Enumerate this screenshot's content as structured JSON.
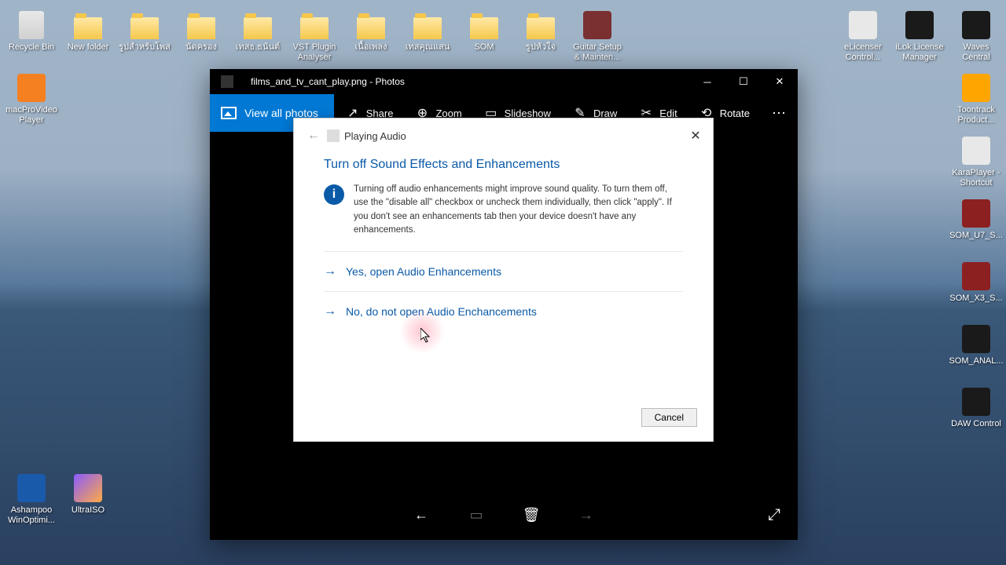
{
  "desktop": {
    "left_rows": [
      [
        {
          "name": "recycle-bin",
          "label": "Recycle Bin",
          "type": "bin"
        },
        {
          "name": "new-folder",
          "label": "New folder",
          "type": "folder"
        },
        {
          "name": "folder-th1",
          "label": "รูปสำหรับโพส",
          "type": "folder"
        },
        {
          "name": "folder-th2",
          "label": "นัดครอง",
          "type": "folder"
        },
        {
          "name": "folder-th3",
          "label": "เทสธ.ธนันต์",
          "type": "folder"
        },
        {
          "name": "vst-plugin",
          "label": "VST Plugin Analyser",
          "type": "folder"
        },
        {
          "name": "folder-th4",
          "label": "เนื้อเพลง",
          "type": "folder"
        },
        {
          "name": "folder-th5",
          "label": "เทสคุณแสน",
          "type": "folder"
        },
        {
          "name": "som",
          "label": "SOM",
          "type": "folder"
        },
        {
          "name": "folder-th6",
          "label": "รูปหัวใจ",
          "type": "folder"
        },
        {
          "name": "guitar-setup",
          "label": "Guitar Setup & Mainten...",
          "type": "app",
          "bg": "#7a3030"
        }
      ],
      [
        {
          "name": "macpro",
          "label": "macProVideo Player",
          "type": "app",
          "bg": "#f58020"
        }
      ]
    ],
    "left_bottom": [
      {
        "name": "ashampoo",
        "label": "Ashampoo WinOptimi...",
        "type": "app",
        "bg": "#1a5aaa"
      },
      {
        "name": "ultraiso",
        "label": "UltraISO",
        "type": "app",
        "bg": "linear-gradient(135deg,#8a5aff,#ffaa44)"
      }
    ],
    "right": [
      {
        "name": "elicenser",
        "label": "eLicenser Control...",
        "type": "app",
        "bg": "#e8e8e8"
      },
      {
        "name": "ilok",
        "label": "iLok License Manager",
        "type": "app",
        "bg": "#1a1a1a"
      },
      {
        "name": "waves",
        "label": "Waves Central",
        "type": "app",
        "bg": "#1a1a1a"
      },
      {
        "name": "toontrack",
        "label": "Toontrack Product...",
        "type": "app",
        "bg": "#ffa500"
      },
      {
        "name": "karaplayer",
        "label": "KaraPlayer - Shortcut",
        "type": "app",
        "bg": "#e8e8e8"
      },
      {
        "name": "som-u7",
        "label": "SOM_U7_S...",
        "type": "app",
        "bg": "#8c2020"
      },
      {
        "name": "som-x3",
        "label": "SOM_X3_S...",
        "type": "app",
        "bg": "#8c2020"
      },
      {
        "name": "som-anal",
        "label": "SOM_ANAL...",
        "type": "app",
        "bg": "#1a1a1a"
      },
      {
        "name": "daw",
        "label": "DAW Control",
        "type": "app",
        "bg": "#1a1a1a"
      }
    ]
  },
  "photos": {
    "title": "films_and_tv_cant_play.png - Photos",
    "view_all": "View all photos",
    "toolbar": {
      "share": "Share",
      "zoom": "Zoom",
      "slideshow": "Slideshow",
      "draw": "Draw",
      "edit": "Edit",
      "rotate": "Rotate"
    }
  },
  "dialog": {
    "breadcrumb": "Playing Audio",
    "heading": "Turn off Sound Effects and Enhancements",
    "body": "Turning off audio enhancements might improve sound quality. To turn them off, use the \"disable all\" checkbox or uncheck them individually, then click \"apply\". If you don't see an enhancements tab then your device doesn't have any enhancements.",
    "link_yes": "Yes, open Audio Enhancements",
    "link_no": "No, do not open Audio Enchancements",
    "cancel": "Cancel"
  }
}
